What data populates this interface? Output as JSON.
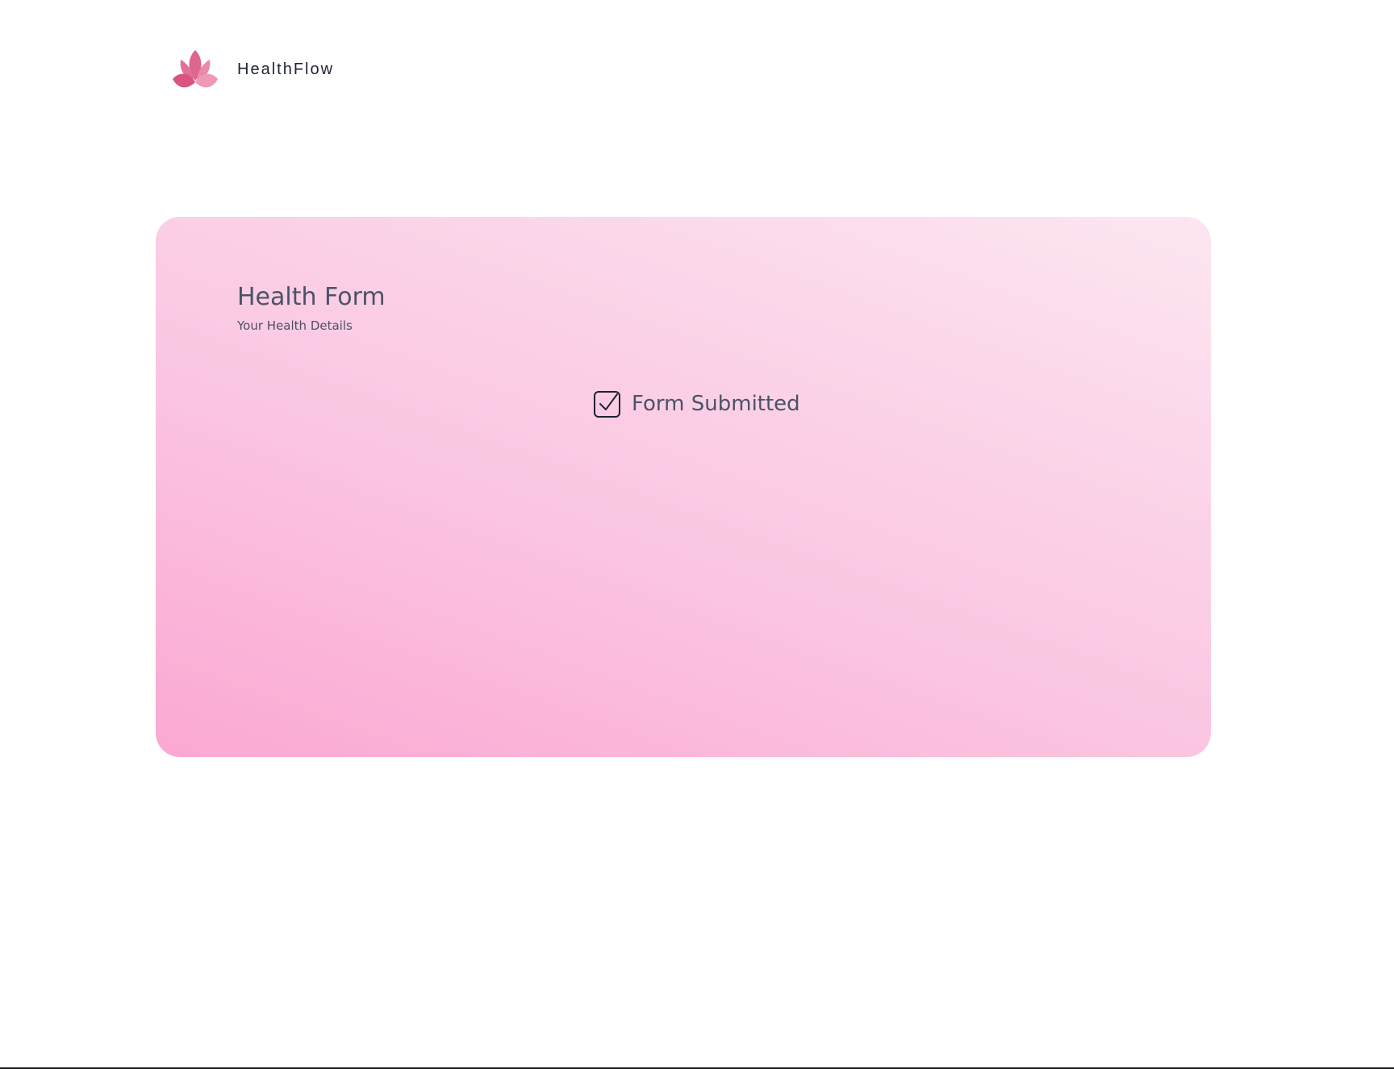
{
  "header": {
    "brand_name": "HealthFlow",
    "logo_icon": "lotus-icon"
  },
  "card": {
    "title": "Health Form",
    "subtitle": "Your Health Details",
    "status_icon": "checkbox-checked-icon",
    "status_text": "Form Submitted"
  },
  "colors": {
    "brand_pink": "#e0628f",
    "text_dark": "#1f2333",
    "text_muted": "#4b5366",
    "card_gradient_start": "#fba8d2",
    "card_gradient_end": "#fce6f1"
  }
}
